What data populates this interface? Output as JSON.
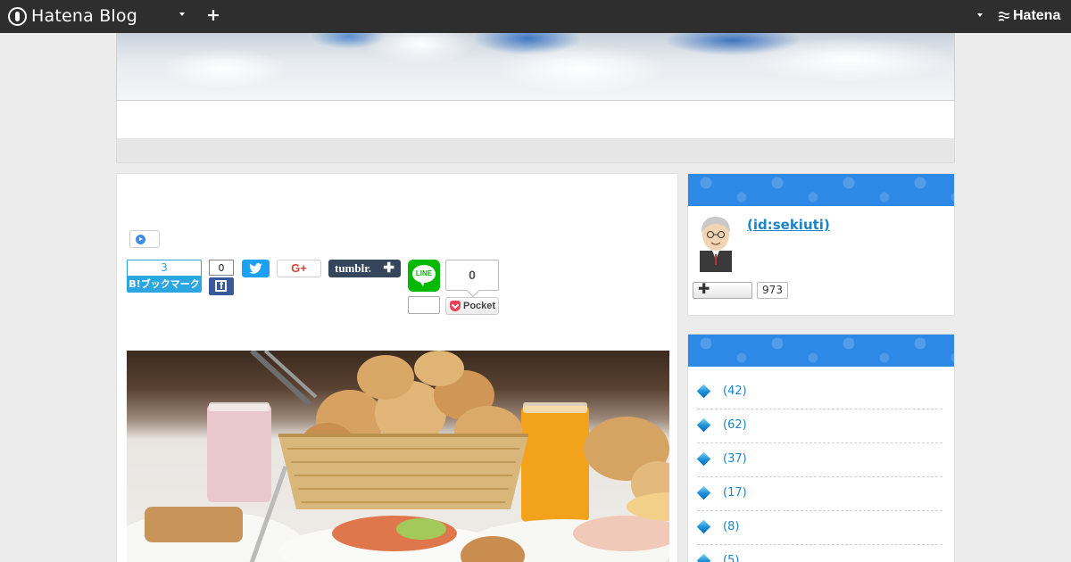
{
  "globalbar": {
    "brand": "Hatena Blog",
    "hatena": "Hatena"
  },
  "share": {
    "hatena_bookmark_count": "3",
    "hatena_bookmark_label": "B!ブックマーク",
    "facebook_count": "0",
    "google_plus_label": "G+",
    "tumblr_label": "tumblr.",
    "tumblr_plus": "✚",
    "line_label": "LINE",
    "pocket_count": "0",
    "pocket_label": "Pocket"
  },
  "profile": {
    "id": " (id:sekiuti)",
    "follow_plus": "✚",
    "followers": "973"
  },
  "categories": {
    "items": [
      {
        "count": "(42)"
      },
      {
        "count": "(62)"
      },
      {
        "count": "(37)"
      },
      {
        "count": "(17)"
      },
      {
        "count": "(8)"
      },
      {
        "count": "(5)"
      }
    ]
  },
  "colors": {
    "globalbar": "#2e2e2e",
    "hatena_blue": "#2ca6e0",
    "module_header": "#2d88e6",
    "link": "#1a85c8"
  }
}
